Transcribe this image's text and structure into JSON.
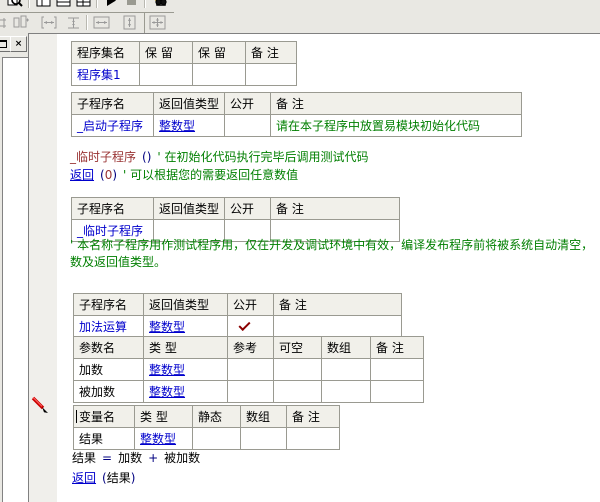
{
  "colors": {
    "link_blue": "#0000CC",
    "operator_navy": "#000080",
    "comment_green": "#007F00",
    "identifier_darkred": "#993333",
    "check_red": "#8B0000",
    "table_header_bg": "#F1F0EA",
    "table_border": "#9A9A91",
    "chrome_bg": "#E9E8E3",
    "gutter_bg": "#F0EFEB"
  },
  "toolbar": {
    "row1_icons": [
      "preview-icon",
      "window-vsplit-icon",
      "window-hsplit-icon",
      "window-grid-icon",
      "run-icon",
      "stop-icon",
      "find-module-icon"
    ],
    "row2_icons": [
      "clipped-align-icon",
      "same-size-icon",
      "h-spacing-icon",
      "v-spacing-icon",
      "same-width-icon",
      "same-height-icon",
      "same-both-icon"
    ]
  },
  "dock": {
    "restore_label": "",
    "close_label": "×"
  },
  "tables": {
    "assembly": {
      "headers": [
        "程序集名",
        "保 留",
        "保 留",
        "备 注"
      ],
      "row": {
        "name": "程序集1",
        "r1": "",
        "r2": "",
        "note": ""
      }
    },
    "startup_sub": {
      "headers": [
        "子程序名",
        "返回值类型",
        "公开",
        "备 注"
      ],
      "row": {
        "name": "_启动子程序",
        "type": "整数型",
        "public": "",
        "note": "请在本子程序中放置易模块初始化代码"
      }
    },
    "temp_sub": {
      "headers": [
        "子程序名",
        "返回值类型",
        "公开",
        "备 注"
      ],
      "row": {
        "name": "_临时子程序",
        "type": "",
        "public": "",
        "note": ""
      }
    },
    "add_sub": {
      "headers": [
        "子程序名",
        "返回值类型",
        "公开",
        "备 注"
      ],
      "row": {
        "name": "加法运算",
        "type": "整数型",
        "public_checked": true,
        "note": ""
      },
      "param_headers": [
        "参数名",
        "类 型",
        "参考",
        "可空",
        "数组",
        "备 注"
      ],
      "params": [
        {
          "name": "加数",
          "type": "整数型"
        },
        {
          "name": "被加数",
          "type": "整数型"
        }
      ]
    },
    "locals": {
      "headers": [
        "变量名",
        "类 型",
        "静态",
        "数组",
        "备 注"
      ],
      "row": {
        "name": "结果",
        "type": "整数型"
      }
    }
  },
  "code": {
    "temp_call": {
      "name": "_临时子程序",
      "args": "()",
      "comment": "'  在初始化代码执行完毕后调用测试代码"
    },
    "return_zero": {
      "keyword": "返回",
      "open": "(",
      "value": "0",
      "close": ")",
      "comment": "'  可以根据您的需要返回任意数值"
    },
    "note_line1": "'  本名称子程序用作测试程序用，仅在开发及调试环境中有效，编译发布程序前将被系统自动清空，",
    "note_line2": "数及返回值类型。",
    "assign": {
      "lhs": "结果",
      "eq": "=",
      "a": "加数",
      "plus": "+",
      "b": "被加数"
    },
    "return_result": {
      "keyword": "返回",
      "open": "(",
      "value": "结果",
      "close": ")"
    }
  }
}
